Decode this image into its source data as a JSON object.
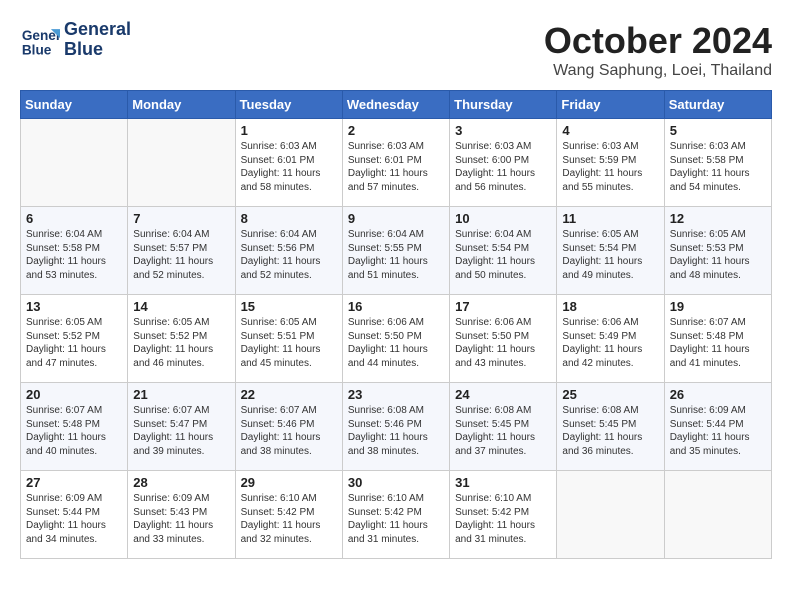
{
  "header": {
    "logo_line1": "General",
    "logo_line2": "Blue",
    "month_title": "October 2024",
    "location": "Wang Saphung, Loei, Thailand"
  },
  "weekdays": [
    "Sunday",
    "Monday",
    "Tuesday",
    "Wednesday",
    "Thursday",
    "Friday",
    "Saturday"
  ],
  "weeks": [
    [
      {
        "day": "",
        "sunrise": "",
        "sunset": "",
        "daylight": ""
      },
      {
        "day": "",
        "sunrise": "",
        "sunset": "",
        "daylight": ""
      },
      {
        "day": "1",
        "sunrise": "Sunrise: 6:03 AM",
        "sunset": "Sunset: 6:01 PM",
        "daylight": "Daylight: 11 hours and 58 minutes."
      },
      {
        "day": "2",
        "sunrise": "Sunrise: 6:03 AM",
        "sunset": "Sunset: 6:01 PM",
        "daylight": "Daylight: 11 hours and 57 minutes."
      },
      {
        "day": "3",
        "sunrise": "Sunrise: 6:03 AM",
        "sunset": "Sunset: 6:00 PM",
        "daylight": "Daylight: 11 hours and 56 minutes."
      },
      {
        "day": "4",
        "sunrise": "Sunrise: 6:03 AM",
        "sunset": "Sunset: 5:59 PM",
        "daylight": "Daylight: 11 hours and 55 minutes."
      },
      {
        "day": "5",
        "sunrise": "Sunrise: 6:03 AM",
        "sunset": "Sunset: 5:58 PM",
        "daylight": "Daylight: 11 hours and 54 minutes."
      }
    ],
    [
      {
        "day": "6",
        "sunrise": "Sunrise: 6:04 AM",
        "sunset": "Sunset: 5:58 PM",
        "daylight": "Daylight: 11 hours and 53 minutes."
      },
      {
        "day": "7",
        "sunrise": "Sunrise: 6:04 AM",
        "sunset": "Sunset: 5:57 PM",
        "daylight": "Daylight: 11 hours and 52 minutes."
      },
      {
        "day": "8",
        "sunrise": "Sunrise: 6:04 AM",
        "sunset": "Sunset: 5:56 PM",
        "daylight": "Daylight: 11 hours and 52 minutes."
      },
      {
        "day": "9",
        "sunrise": "Sunrise: 6:04 AM",
        "sunset": "Sunset: 5:55 PM",
        "daylight": "Daylight: 11 hours and 51 minutes."
      },
      {
        "day": "10",
        "sunrise": "Sunrise: 6:04 AM",
        "sunset": "Sunset: 5:54 PM",
        "daylight": "Daylight: 11 hours and 50 minutes."
      },
      {
        "day": "11",
        "sunrise": "Sunrise: 6:05 AM",
        "sunset": "Sunset: 5:54 PM",
        "daylight": "Daylight: 11 hours and 49 minutes."
      },
      {
        "day": "12",
        "sunrise": "Sunrise: 6:05 AM",
        "sunset": "Sunset: 5:53 PM",
        "daylight": "Daylight: 11 hours and 48 minutes."
      }
    ],
    [
      {
        "day": "13",
        "sunrise": "Sunrise: 6:05 AM",
        "sunset": "Sunset: 5:52 PM",
        "daylight": "Daylight: 11 hours and 47 minutes."
      },
      {
        "day": "14",
        "sunrise": "Sunrise: 6:05 AM",
        "sunset": "Sunset: 5:52 PM",
        "daylight": "Daylight: 11 hours and 46 minutes."
      },
      {
        "day": "15",
        "sunrise": "Sunrise: 6:05 AM",
        "sunset": "Sunset: 5:51 PM",
        "daylight": "Daylight: 11 hours and 45 minutes."
      },
      {
        "day": "16",
        "sunrise": "Sunrise: 6:06 AM",
        "sunset": "Sunset: 5:50 PM",
        "daylight": "Daylight: 11 hours and 44 minutes."
      },
      {
        "day": "17",
        "sunrise": "Sunrise: 6:06 AM",
        "sunset": "Sunset: 5:50 PM",
        "daylight": "Daylight: 11 hours and 43 minutes."
      },
      {
        "day": "18",
        "sunrise": "Sunrise: 6:06 AM",
        "sunset": "Sunset: 5:49 PM",
        "daylight": "Daylight: 11 hours and 42 minutes."
      },
      {
        "day": "19",
        "sunrise": "Sunrise: 6:07 AM",
        "sunset": "Sunset: 5:48 PM",
        "daylight": "Daylight: 11 hours and 41 minutes."
      }
    ],
    [
      {
        "day": "20",
        "sunrise": "Sunrise: 6:07 AM",
        "sunset": "Sunset: 5:48 PM",
        "daylight": "Daylight: 11 hours and 40 minutes."
      },
      {
        "day": "21",
        "sunrise": "Sunrise: 6:07 AM",
        "sunset": "Sunset: 5:47 PM",
        "daylight": "Daylight: 11 hours and 39 minutes."
      },
      {
        "day": "22",
        "sunrise": "Sunrise: 6:07 AM",
        "sunset": "Sunset: 5:46 PM",
        "daylight": "Daylight: 11 hours and 38 minutes."
      },
      {
        "day": "23",
        "sunrise": "Sunrise: 6:08 AM",
        "sunset": "Sunset: 5:46 PM",
        "daylight": "Daylight: 11 hours and 38 minutes."
      },
      {
        "day": "24",
        "sunrise": "Sunrise: 6:08 AM",
        "sunset": "Sunset: 5:45 PM",
        "daylight": "Daylight: 11 hours and 37 minutes."
      },
      {
        "day": "25",
        "sunrise": "Sunrise: 6:08 AM",
        "sunset": "Sunset: 5:45 PM",
        "daylight": "Daylight: 11 hours and 36 minutes."
      },
      {
        "day": "26",
        "sunrise": "Sunrise: 6:09 AM",
        "sunset": "Sunset: 5:44 PM",
        "daylight": "Daylight: 11 hours and 35 minutes."
      }
    ],
    [
      {
        "day": "27",
        "sunrise": "Sunrise: 6:09 AM",
        "sunset": "Sunset: 5:44 PM",
        "daylight": "Daylight: 11 hours and 34 minutes."
      },
      {
        "day": "28",
        "sunrise": "Sunrise: 6:09 AM",
        "sunset": "Sunset: 5:43 PM",
        "daylight": "Daylight: 11 hours and 33 minutes."
      },
      {
        "day": "29",
        "sunrise": "Sunrise: 6:10 AM",
        "sunset": "Sunset: 5:42 PM",
        "daylight": "Daylight: 11 hours and 32 minutes."
      },
      {
        "day": "30",
        "sunrise": "Sunrise: 6:10 AM",
        "sunset": "Sunset: 5:42 PM",
        "daylight": "Daylight: 11 hours and 31 minutes."
      },
      {
        "day": "31",
        "sunrise": "Sunrise: 6:10 AM",
        "sunset": "Sunset: 5:42 PM",
        "daylight": "Daylight: 11 hours and 31 minutes."
      },
      {
        "day": "",
        "sunrise": "",
        "sunset": "",
        "daylight": ""
      },
      {
        "day": "",
        "sunrise": "",
        "sunset": "",
        "daylight": ""
      }
    ]
  ]
}
